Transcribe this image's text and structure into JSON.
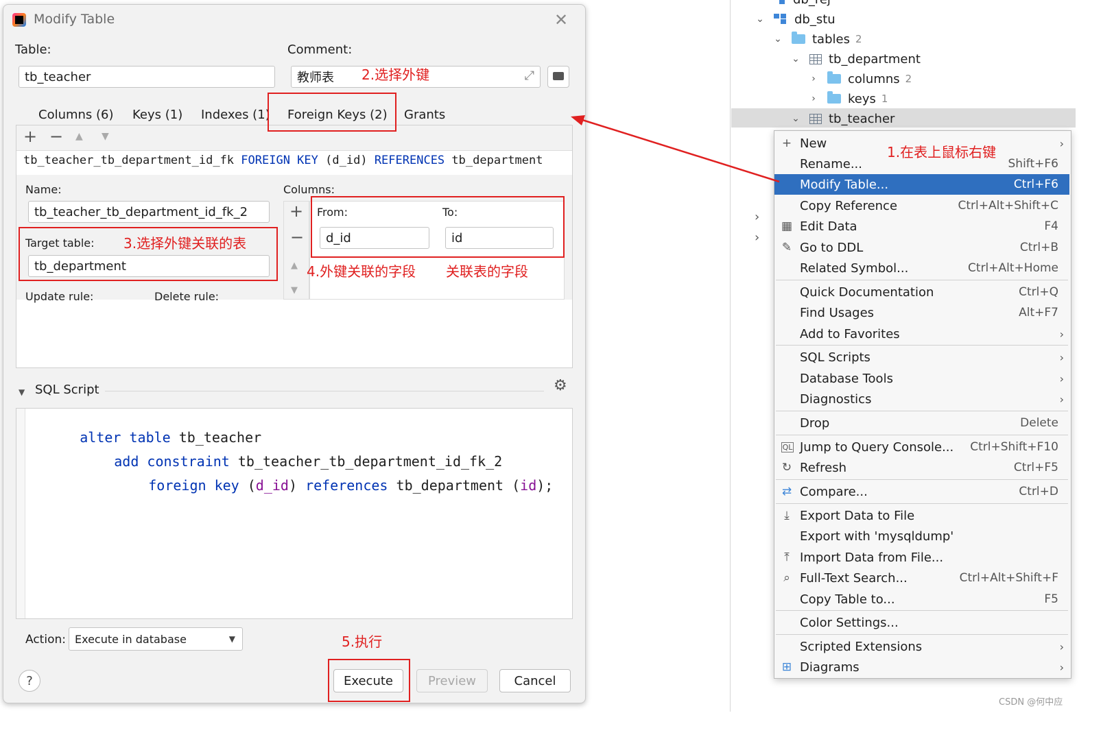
{
  "dialog": {
    "title": "Modify Table",
    "table_label": "Table:",
    "table_value": "tb_teacher",
    "comment_label": "Comment:",
    "comment_value": "教师表",
    "tabs": [
      {
        "label": "Columns (6)"
      },
      {
        "label": "Keys (1)"
      },
      {
        "label": "Indexes (1)"
      },
      {
        "label": "Foreign Keys (2)"
      },
      {
        "label": "Grants"
      }
    ],
    "fk_line": {
      "name": "tb_teacher_tb_department_id_fk",
      "kw1": "FOREIGN KEY",
      "cols": "(d_id)",
      "kw2": "REFERENCES",
      "ref": "tb_department"
    },
    "name_label": "Name:",
    "name_value": "tb_teacher_tb_department_id_fk_2",
    "target_label": "Target table:",
    "target_value": "tb_department",
    "update_rule_label": "Update rule:",
    "delete_rule_label": "Delete rule:",
    "columns_label": "Columns:",
    "from_label": "From:",
    "to_label": "To:",
    "from_value": "d_id",
    "to_value": "id",
    "sql_section_label": "SQL Script",
    "sql": {
      "l1_kw": "alter table",
      "l1_rest": "tb_teacher",
      "l2_kw": "add constraint",
      "l2_rest": "tb_teacher_tb_department_id_fk_2",
      "l3_kw1": "foreign key",
      "l3_p1": "(",
      "l3_col": "d_id",
      "l3_p2": ")",
      "l3_kw2": "references",
      "l3_ref": "tb_department",
      "l3_p3": "(",
      "l3_col2": "id",
      "l3_p4": ");"
    },
    "action_label": "Action:",
    "action_value": "Execute in database",
    "buttons": {
      "execute": "Execute",
      "preview": "Preview",
      "cancel": "Cancel",
      "help": "?"
    }
  },
  "annotations": {
    "a1": "1.在表上鼠标右键",
    "a2": "2.选择外键",
    "a3": "3.选择外键关联的表",
    "a4": "4.外键关联的字段",
    "a4b": "关联表的字段",
    "a5": "5.执行"
  },
  "tree": {
    "items": [
      {
        "label": "db_rej"
      },
      {
        "label": "db_stu"
      },
      {
        "label": "tables",
        "count": "2"
      },
      {
        "label": "tb_department"
      },
      {
        "label": "columns",
        "count": "2"
      },
      {
        "label": "keys",
        "count": "1"
      },
      {
        "label": "tb_teacher"
      }
    ]
  },
  "menu": {
    "items": [
      {
        "label": "New",
        "shortcut": "",
        "arrow": true
      },
      {
        "label": "Rename...",
        "shortcut": "Shift+F6"
      },
      {
        "label": "Modify Table...",
        "shortcut": "Ctrl+F6"
      },
      {
        "label": "Copy Reference",
        "shortcut": "Ctrl+Alt+Shift+C"
      },
      {
        "label": "Edit Data",
        "shortcut": "F4"
      },
      {
        "label": "Go to DDL",
        "shortcut": "Ctrl+B"
      },
      {
        "label": "Related Symbol...",
        "shortcut": "Ctrl+Alt+Home"
      },
      {
        "label": "Quick Documentation",
        "shortcut": "Ctrl+Q"
      },
      {
        "label": "Find Usages",
        "shortcut": "Alt+F7"
      },
      {
        "label": "Add to Favorites",
        "shortcut": "",
        "arrow": true
      },
      {
        "label": "SQL Scripts",
        "shortcut": "",
        "arrow": true
      },
      {
        "label": "Database Tools",
        "shortcut": "",
        "arrow": true
      },
      {
        "label": "Diagnostics",
        "shortcut": "",
        "arrow": true
      },
      {
        "label": "Drop",
        "shortcut": "Delete"
      },
      {
        "label": "Jump to Query Console...",
        "shortcut": "Ctrl+Shift+F10"
      },
      {
        "label": "Refresh",
        "shortcut": "Ctrl+F5"
      },
      {
        "label": "Compare...",
        "shortcut": "Ctrl+D"
      },
      {
        "label": "Export Data to File",
        "shortcut": ""
      },
      {
        "label": "Export with 'mysqldump'",
        "shortcut": ""
      },
      {
        "label": "Import Data from File...",
        "shortcut": ""
      },
      {
        "label": "Full-Text Search...",
        "shortcut": "Ctrl+Alt+Shift+F"
      },
      {
        "label": "Copy Table to...",
        "shortcut": "F5"
      },
      {
        "label": "Color Settings...",
        "shortcut": ""
      },
      {
        "label": "Scripted Extensions",
        "shortcut": "",
        "arrow": true
      },
      {
        "label": "Diagrams",
        "shortcut": "",
        "arrow": true
      }
    ]
  },
  "watermark": "CSDN @何中应",
  "colors": {
    "accent": "#2f6fbf",
    "annotation": "#e02020",
    "keyword": "#0033b3"
  }
}
